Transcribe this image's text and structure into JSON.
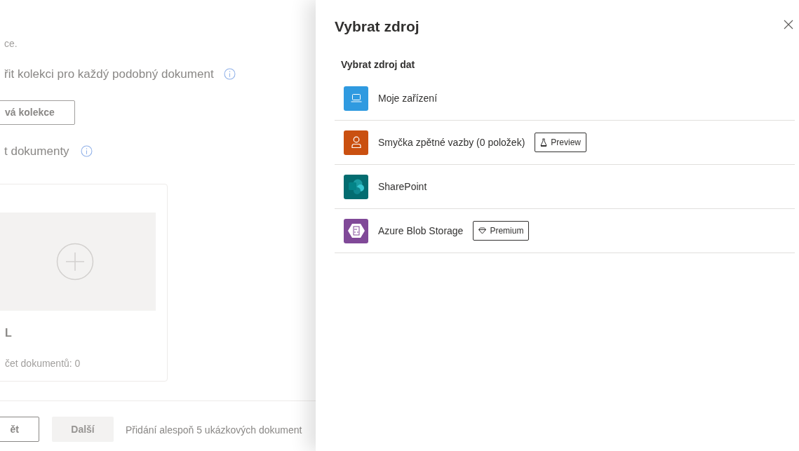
{
  "background_page": {
    "description_tail": "ce.",
    "collection_heading": "řit kolekci pro každý podobný dokument",
    "new_collection_button": "vá kolekce",
    "documents_heading": "t dokumenty",
    "collection_card": {
      "title": "L",
      "count": "čet dokumentů: 0"
    },
    "footer": {
      "back_button": "ět",
      "next_button": {
        "label": "Další",
        "disabled": true
      },
      "hint": "Přidání alespoň 5 ukázkových dokument"
    }
  },
  "panel": {
    "title": "Vybrat zdroj",
    "section_label": "Vybrat zdroj dat",
    "sources": [
      {
        "kind": "device",
        "label": "Moje zařízení",
        "color": "#2f9ae0"
      },
      {
        "kind": "feedback",
        "label": "Smyčka zpětné vazby (0 položek)",
        "color": "#ca5010",
        "badge": {
          "kind": "preview",
          "label": "Preview"
        }
      },
      {
        "kind": "sharepoint",
        "label": "SharePoint",
        "color": "#036c70"
      },
      {
        "kind": "azure",
        "label": "Azure Blob Storage",
        "color": "#804998",
        "badge": {
          "kind": "premium",
          "label": "Premium"
        }
      }
    ]
  }
}
